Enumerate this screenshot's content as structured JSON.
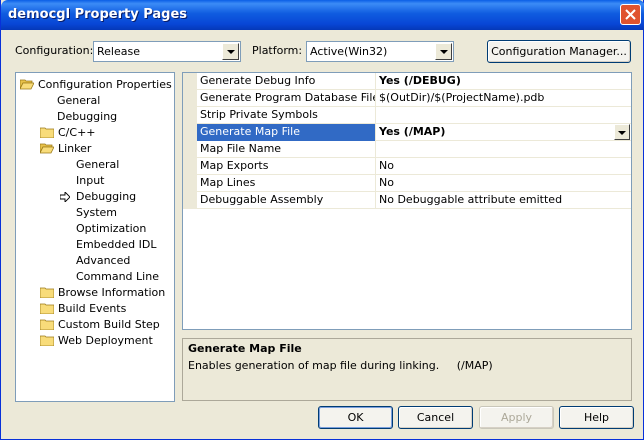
{
  "window": {
    "title": "democgl Property Pages"
  },
  "toolbar": {
    "configuration_label": "Configuration:",
    "configuration_value": "Release",
    "platform_label": "Platform:",
    "platform_value": "Active(Win32)",
    "config_manager_label": "Configuration Manager..."
  },
  "tree": {
    "items": [
      {
        "label": "Configuration Properties",
        "icon": "folder-open-icon"
      },
      {
        "label": "General"
      },
      {
        "label": "Debugging"
      },
      {
        "label": "C/C++",
        "icon": "folder-icon"
      },
      {
        "label": "Linker",
        "icon": "folder-open-icon"
      },
      {
        "label": "General"
      },
      {
        "label": "Input"
      },
      {
        "label": "Debugging",
        "selected_marker": "arrow-icon"
      },
      {
        "label": "System"
      },
      {
        "label": "Optimization"
      },
      {
        "label": "Embedded IDL"
      },
      {
        "label": "Advanced"
      },
      {
        "label": "Command Line"
      },
      {
        "label": "Browse Information",
        "icon": "folder-icon"
      },
      {
        "label": "Build Events",
        "icon": "folder-icon"
      },
      {
        "label": "Custom Build Step",
        "icon": "folder-icon"
      },
      {
        "label": "Web Deployment",
        "icon": "folder-icon"
      }
    ]
  },
  "grid": {
    "rows": [
      {
        "name": "Generate Debug Info",
        "value": "Yes (/DEBUG)"
      },
      {
        "name": "Generate Program Database File",
        "value": "$(OutDir)/$(ProjectName).pdb"
      },
      {
        "name": "Strip Private Symbols",
        "value": ""
      },
      {
        "name": "Generate Map File",
        "value": "Yes (/MAP)"
      },
      {
        "name": "Map File Name",
        "value": ""
      },
      {
        "name": "Map Exports",
        "value": "No"
      },
      {
        "name": "Map Lines",
        "value": "No"
      },
      {
        "name": "Debuggable Assembly",
        "value": "No Debuggable attribute emitted"
      }
    ]
  },
  "description": {
    "title": "Generate Map File",
    "text": "Enables generation of map file during linking.     (/MAP)"
  },
  "buttons": {
    "ok": "OK",
    "cancel": "Cancel",
    "apply": "Apply",
    "help": "Help"
  },
  "colors": {
    "titlebar": "#0a5ee6",
    "selection": "#316ac5",
    "dialog_bg": "#ece9d8",
    "close_button": "#e0532f"
  }
}
